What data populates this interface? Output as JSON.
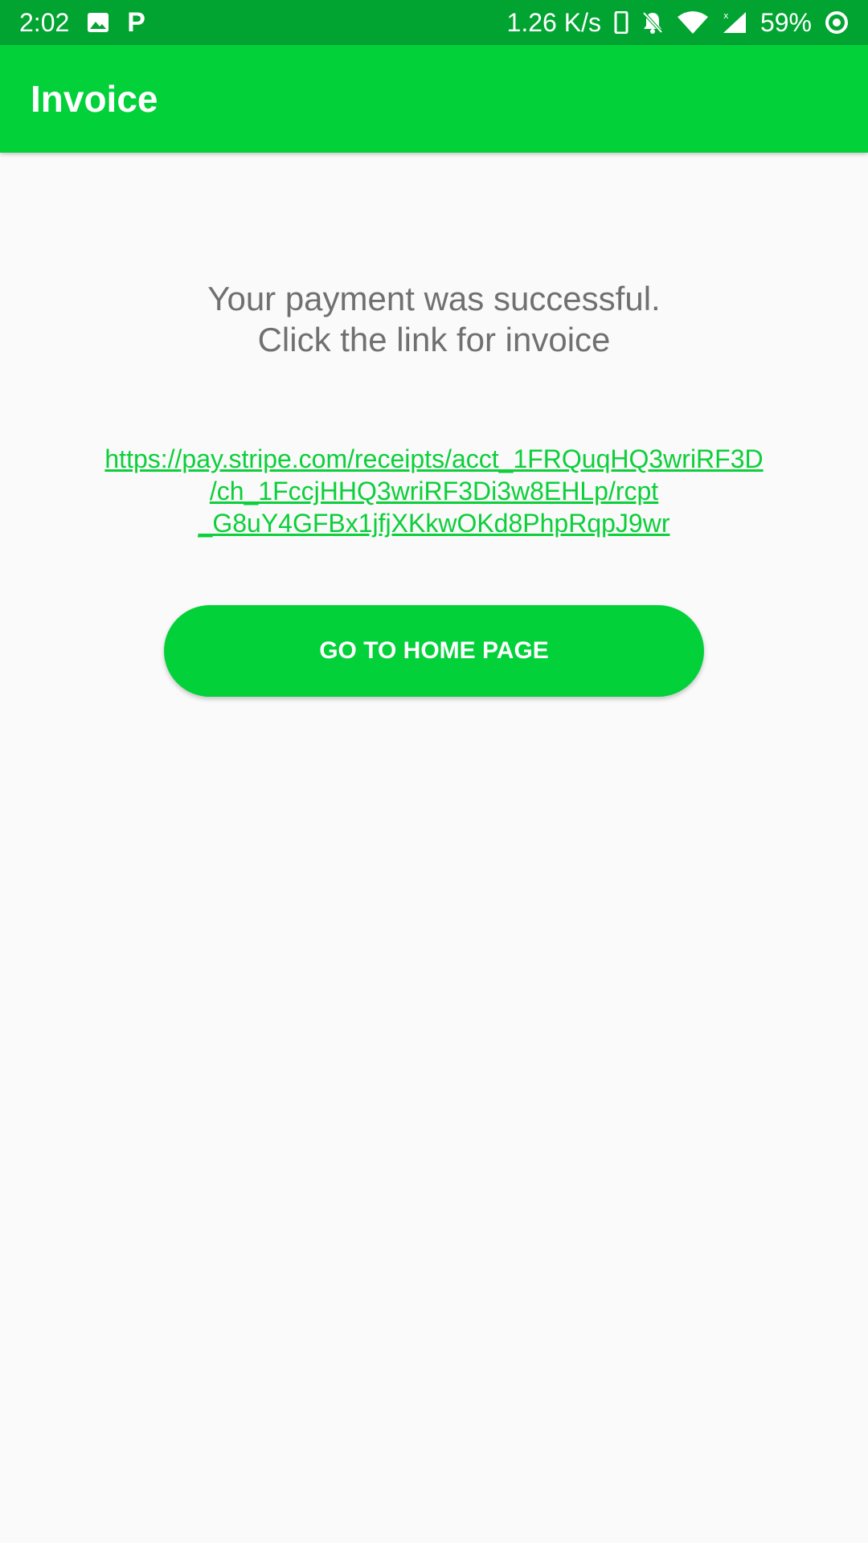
{
  "status_bar": {
    "time": "2:02",
    "net_speed": "1.26 K/s",
    "battery": "59%",
    "p_badge": "P",
    "icons": [
      "image-icon",
      "p-app-icon",
      "phone-icon",
      "bell-off-icon",
      "wifi-icon",
      "signal-icon",
      "battery-saver-icon"
    ],
    "background_color": "#01a431"
  },
  "app_bar": {
    "title": "Invoice",
    "background_color": "#03d13a"
  },
  "main": {
    "message_line1": "Your payment was successful.",
    "message_line2": "Click the link for invoice",
    "link_line1": "https://pay.stripe.com/receipts/acct_1FRQuqHQ3wriRF3D",
    "link_line2": "/ch_1FccjHHQ3wriRF3Di3w8EHLp/rcpt",
    "link_line3": "_G8uY4GFBx1jfjXKkwOKd8PhpRqpJ9wr",
    "link_color": "#0ccf3a",
    "button_label": "GO TO HOME PAGE",
    "button_color": "#03d13a"
  }
}
